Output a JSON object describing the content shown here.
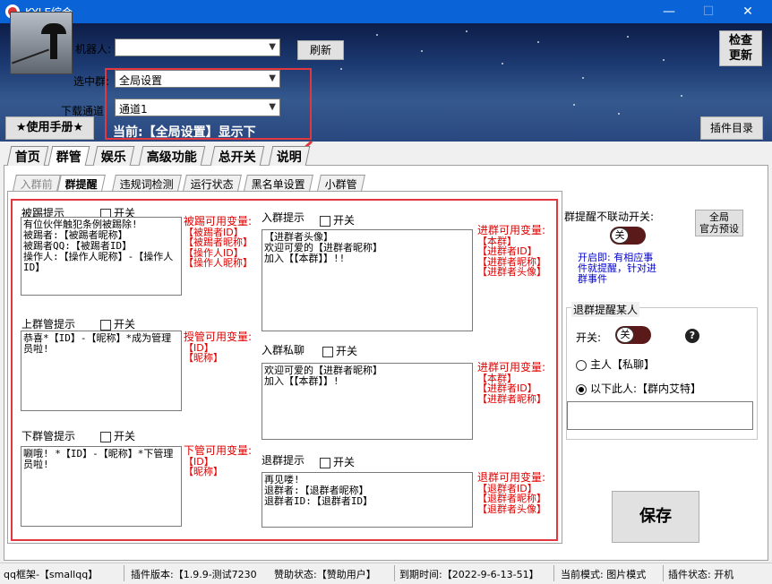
{
  "window": {
    "title": "KYLE综合",
    "minimize": "—",
    "maximize": "☐",
    "close": "✕"
  },
  "header": {
    "robot_label": "机器人:",
    "robot_value": "",
    "refresh_button": "刷新",
    "group_label": "选中群:",
    "group_value": "全局设置",
    "channel_label": "下载通道:",
    "channel_value": "通道1",
    "current_text": "当前:【全局设置】显示下",
    "manual_button": "★使用手册★",
    "check_update_button": "检查\n更新",
    "plugin_dir_button": "插件目录"
  },
  "tabs": [
    {
      "label": "首页",
      "active": false
    },
    {
      "label": "群管",
      "active": true
    },
    {
      "label": "娱乐",
      "active": false
    },
    {
      "label": "高级功能",
      "active": false
    },
    {
      "label": "总开关",
      "active": false
    },
    {
      "label": "说明",
      "active": false
    }
  ],
  "subtabs": [
    {
      "label": "入群前",
      "active": false
    },
    {
      "label": "群提醒",
      "active": true
    },
    {
      "label": "违规词检测",
      "active": false
    },
    {
      "label": "运行状态",
      "active": false
    },
    {
      "label": "黑名单设置",
      "active": false
    },
    {
      "label": "小群管",
      "active": false
    }
  ],
  "kick": {
    "title": "被踢提示",
    "switch": "开关",
    "text": "有位伙伴触犯条例被踢除!\n被踢者:【被踢者昵称】\n被踢者QQ:【被踢者ID】\n操作人:【操作人昵称】-【操作人ID】",
    "vars_title": "被踢可用变量:",
    "vars": [
      "【被踢者ID】",
      "【被踢者昵称】",
      "【操作人ID】",
      "【操作人昵称】"
    ]
  },
  "promote": {
    "title": "上群管提示",
    "switch": "开关",
    "text": "恭喜*【ID】-【昵称】*成为管理员啦!",
    "vars_title": "授管可用变量:",
    "vars": [
      "【ID】",
      "【昵称】"
    ]
  },
  "demote": {
    "title": "下群管提示",
    "switch": "开关",
    "text": "唰哦! *【ID】-【昵称】*下管理员啦!",
    "vars_title": "下管可用变量:",
    "vars": [
      "【ID】",
      "【昵称】"
    ]
  },
  "join": {
    "title": "入群提示",
    "switch": "开关",
    "text": "【进群者头像】\n欢迎可爱的【进群者昵称】\n加入【【本群】】!!",
    "vars_title": "进群可用变量:",
    "vars": [
      "【本群】",
      "【进群者ID】",
      "【进群者昵称】",
      "【进群者头像】"
    ]
  },
  "join_private": {
    "title": "入群私聊",
    "switch": "开关",
    "text": "欢迎可爱的【进群者昵称】\n加入【【本群】】!",
    "vars_title": "进群可用变量:",
    "vars": [
      "【本群】",
      "【进群者ID】",
      "【进群者昵称】"
    ]
  },
  "leave": {
    "title": "退群提示",
    "switch": "开关",
    "text": "再见喽!\n退群者:【退群者昵称】\n退群者ID:【退群者ID】",
    "vars_title": "退群可用变量:",
    "vars": [
      "【退群者ID】",
      "【退群者昵称】",
      "【退群者头像】"
    ]
  },
  "right": {
    "linkage_label": "群提醒不联动开关:",
    "preset_button": "全局\n官方预设",
    "toggle_text": "关",
    "note": "开启即: 有相应事件就提醒，针对进群事件",
    "leave_remind_title": "退群提醒某人",
    "switch_label": "开关:",
    "help_icon": "?",
    "radio_owner": "主人【私聊】",
    "radio_below": "以下此人:【群内艾特】",
    "target_input": "",
    "save_button": "保存"
  },
  "status": {
    "framework": "qq框架-【smallqq】",
    "version": "插件版本:【1.9.9-测试7230",
    "sponsor": "赞助状态:【赞助用户】",
    "expire": "到期时间:【2022-9-6-13-51】",
    "mode": "当前模式: 图片模式",
    "plugin_state": "插件状态: 开机"
  },
  "colors": {
    "accent_red": "#e0383e",
    "var_red": "#e00000",
    "note_blue": "#0000d0",
    "titlebar": "#0a64d8"
  }
}
